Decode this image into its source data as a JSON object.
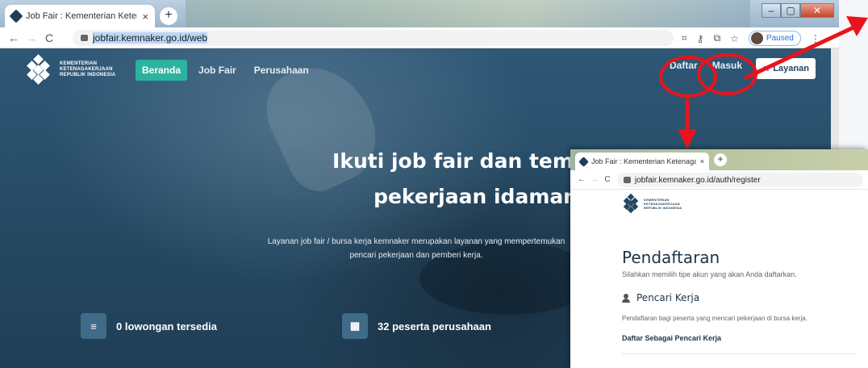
{
  "browser": {
    "tab_title": "Job Fair : Kementerian Ketenagaker",
    "new_tab": "+",
    "url": "jobfair.kemnaker.go.id/web",
    "profile_status": "Paused",
    "window_controls": {
      "minimize": "–",
      "maximize": "▢",
      "close": "✕"
    }
  },
  "site": {
    "brand_lines": [
      "KEMENTERIAN",
      "KETENAGAKERJAAN",
      "REPUBLIK INDONESIA"
    ],
    "nav": [
      {
        "label": "Beranda",
        "active": true
      },
      {
        "label": "Job Fair",
        "active": false
      },
      {
        "label": "Perusahaan",
        "active": false
      }
    ],
    "auth": {
      "register": "Daftar",
      "login": "Masuk"
    },
    "services_label": "Layanan"
  },
  "hero": {
    "headline_line1": "Ikuti job fair dan temukan",
    "headline_line2": "pekerjaan idaman mu!",
    "subtext_line1": "Layanan job fair / bursa kerja kemnaker merupakan layanan yang mempertemukan",
    "subtext_line2": "pencari pekerjaan dan pemberi kerja.",
    "stats": [
      {
        "icon": "list-icon",
        "label": "0 lowongan tersedia"
      },
      {
        "icon": "building-icon",
        "label": "32 peserta perusahaan"
      }
    ]
  },
  "register_window": {
    "tab_title": "Job Fair : Kementerian Ketenaga",
    "new_tab": "+",
    "url": "jobfair.kemnaker.go.id/auth/register",
    "brand_lines": [
      "KEMENTERIAN",
      "KETENAGAKERJAAN",
      "REPUBLIK INDONESIA"
    ],
    "title": "Pendaftaran",
    "subtitle": "Silahkan memilih tipe akun yang akan Anda daftarkan.",
    "role_title": "Pencari Kerja",
    "role_desc": "Pendaftaran bagi peserta yang mencari pekerjaan di bursa kerja.",
    "role_link": "Daftar Sebagai Pencari Kerja"
  },
  "colors": {
    "annotation": "#e8141b",
    "accent": "#2bb3a0",
    "navy": "#24465f"
  }
}
